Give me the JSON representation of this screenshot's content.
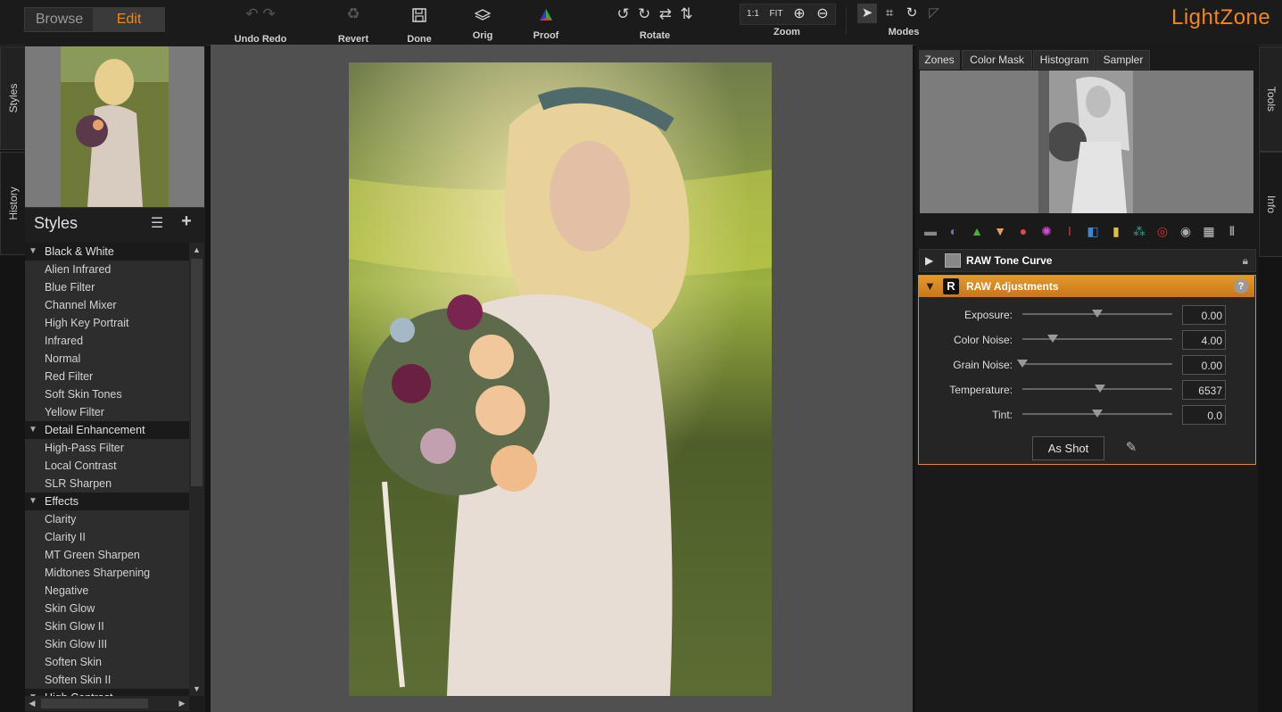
{
  "app": {
    "logo": "LightZone"
  },
  "modes_tabs": {
    "browse": "Browse",
    "edit": "Edit"
  },
  "toolbar": {
    "undo_redo": "Undo Redo",
    "revert": "Revert",
    "done": "Done",
    "orig": "Orig",
    "proof": "Proof",
    "rotate": "Rotate",
    "zoom": "Zoom",
    "zoom_1to1": "1:1",
    "zoom_fit": "FIT",
    "modes": "Modes"
  },
  "left_tabs": {
    "styles": "Styles",
    "history": "History"
  },
  "styles_panel": {
    "title": "Styles",
    "rows": [
      {
        "label": "Black & White",
        "category": true
      },
      {
        "label": "Alien Infrared",
        "category": false
      },
      {
        "label": "Blue Filter",
        "category": false
      },
      {
        "label": "Channel Mixer",
        "category": false
      },
      {
        "label": "High Key Portrait",
        "category": false
      },
      {
        "label": "Infrared",
        "category": false
      },
      {
        "label": "Normal",
        "category": false
      },
      {
        "label": "Red Filter",
        "category": false
      },
      {
        "label": "Soft Skin Tones",
        "category": false
      },
      {
        "label": "Yellow Filter",
        "category": false
      },
      {
        "label": "Detail Enhancement",
        "category": true
      },
      {
        "label": "High-Pass Filter",
        "category": false
      },
      {
        "label": "Local Contrast",
        "category": false
      },
      {
        "label": "SLR Sharpen",
        "category": false
      },
      {
        "label": "Effects",
        "category": true
      },
      {
        "label": "Clarity",
        "category": false
      },
      {
        "label": "Clarity II",
        "category": false
      },
      {
        "label": "MT Green Sharpen",
        "category": false
      },
      {
        "label": "Midtones Sharpening",
        "category": false
      },
      {
        "label": "Negative",
        "category": false
      },
      {
        "label": "Skin Glow",
        "category": false
      },
      {
        "label": "Skin Glow II",
        "category": false
      },
      {
        "label": "Skin Glow III",
        "category": false
      },
      {
        "label": "Soften Skin",
        "category": false
      },
      {
        "label": "Soften Skin II",
        "category": false
      },
      {
        "label": "High Contrast",
        "category": true
      }
    ]
  },
  "right_tabs": {
    "zones": "Zones",
    "color_mask": "Color Mask",
    "histogram": "Histogram",
    "sampler": "Sampler"
  },
  "right_side_tabs": {
    "tools": "Tools",
    "info": "Info"
  },
  "tools": {
    "tone_curve": "RAW Tone Curve",
    "raw_adjustments": "RAW Adjustments",
    "sliders": [
      {
        "label": "Exposure:",
        "value": "0.00",
        "position": 0.5
      },
      {
        "label": "Color Noise:",
        "value": "4.00",
        "position": 0.2
      },
      {
        "label": "Grain Noise:",
        "value": "0.00",
        "position": 0.0
      },
      {
        "label": "Temperature:",
        "value": "6537",
        "position": 0.52
      },
      {
        "label": "Tint:",
        "value": "0.0",
        "position": 0.5
      }
    ],
    "as_shot": "As Shot"
  }
}
